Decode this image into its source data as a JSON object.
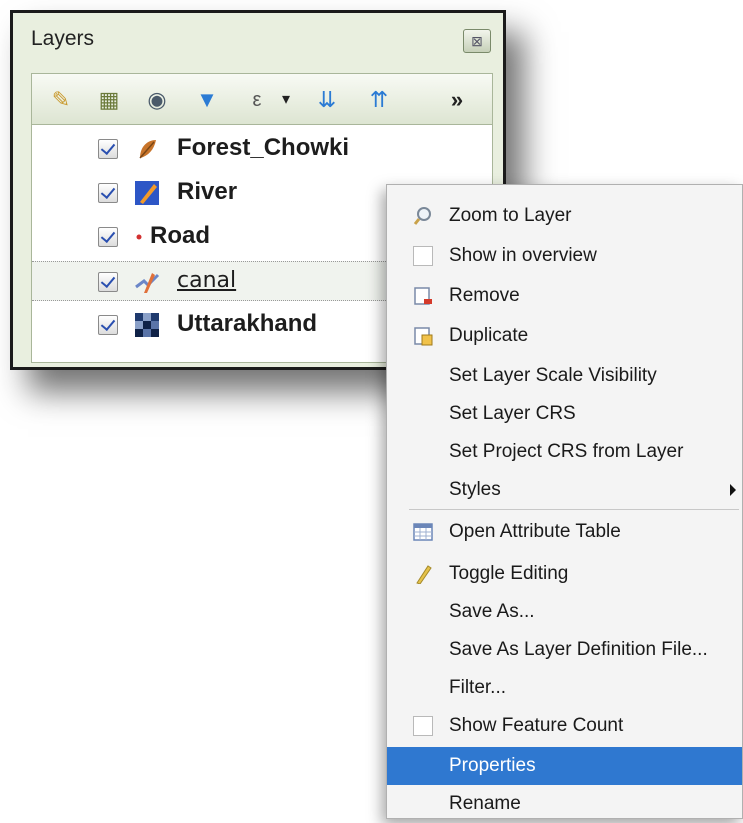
{
  "panel": {
    "title": "Layers",
    "close_icon": "dock-close-icon",
    "toolbar": [
      {
        "name": "style-brush-icon",
        "glyph": "🖌",
        "color": "#c99a2e"
      },
      {
        "name": "add-group-icon",
        "glyph": "▦",
        "color": "#6b7a3a"
      },
      {
        "name": "manage-visibility-icon",
        "glyph": "👁",
        "color": "#4a5a6a"
      },
      {
        "name": "filter-legend-icon",
        "glyph": "▼",
        "color": "#2b7bd4"
      },
      {
        "name": "filter-by-expression-icon",
        "glyph": "ε",
        "color": "#555555"
      },
      {
        "name": "dropdown-arrow-icon",
        "glyph": "▾",
        "color": "#222222"
      },
      {
        "name": "expand-all-icon",
        "glyph": "⇊",
        "color": "#2b7bd4"
      },
      {
        "name": "collapse-all-icon",
        "glyph": "⇈",
        "color": "#2b7bd4"
      },
      {
        "name": "more-tools-icon",
        "glyph": "»",
        "color": "#222222"
      }
    ],
    "layers": [
      {
        "label": "Forest_Chowki",
        "icon": "point-layer-icon",
        "checked": true
      },
      {
        "label": "River",
        "icon": "line-layer-icon",
        "checked": true
      },
      {
        "label": "Road",
        "icon": "road-dot-icon",
        "checked": true
      },
      {
        "label": "canal",
        "icon": "line-edit-layer-icon",
        "checked": true,
        "selected": true
      },
      {
        "label": "Uttarakhand",
        "icon": "raster-layer-icon",
        "checked": true
      }
    ]
  },
  "menu": {
    "items": [
      {
        "label": "Zoom to Layer",
        "icon": "zoom-icon"
      },
      {
        "label": "Show in overview",
        "icon": "checkbox-icon"
      },
      {
        "label": "Remove",
        "icon": "remove-icon"
      },
      {
        "label": "Duplicate",
        "icon": "duplicate-icon"
      },
      {
        "label": "Set Layer Scale Visibility"
      },
      {
        "label": "Set Layer CRS"
      },
      {
        "label": "Set Project CRS from Layer"
      },
      {
        "label": "Styles",
        "submenu": true
      },
      {
        "label": "Open Attribute Table",
        "icon": "table-icon"
      },
      {
        "label": "Toggle Editing",
        "icon": "pencil-icon"
      },
      {
        "label": "Save As..."
      },
      {
        "label": "Save As Layer Definition File..."
      },
      {
        "label": "Filter..."
      },
      {
        "label": "Show Feature Count",
        "icon": "checkbox-icon"
      },
      {
        "label": "Properties",
        "selected": true
      },
      {
        "label": "Rename"
      }
    ],
    "selection_color": "#2f78d0"
  }
}
